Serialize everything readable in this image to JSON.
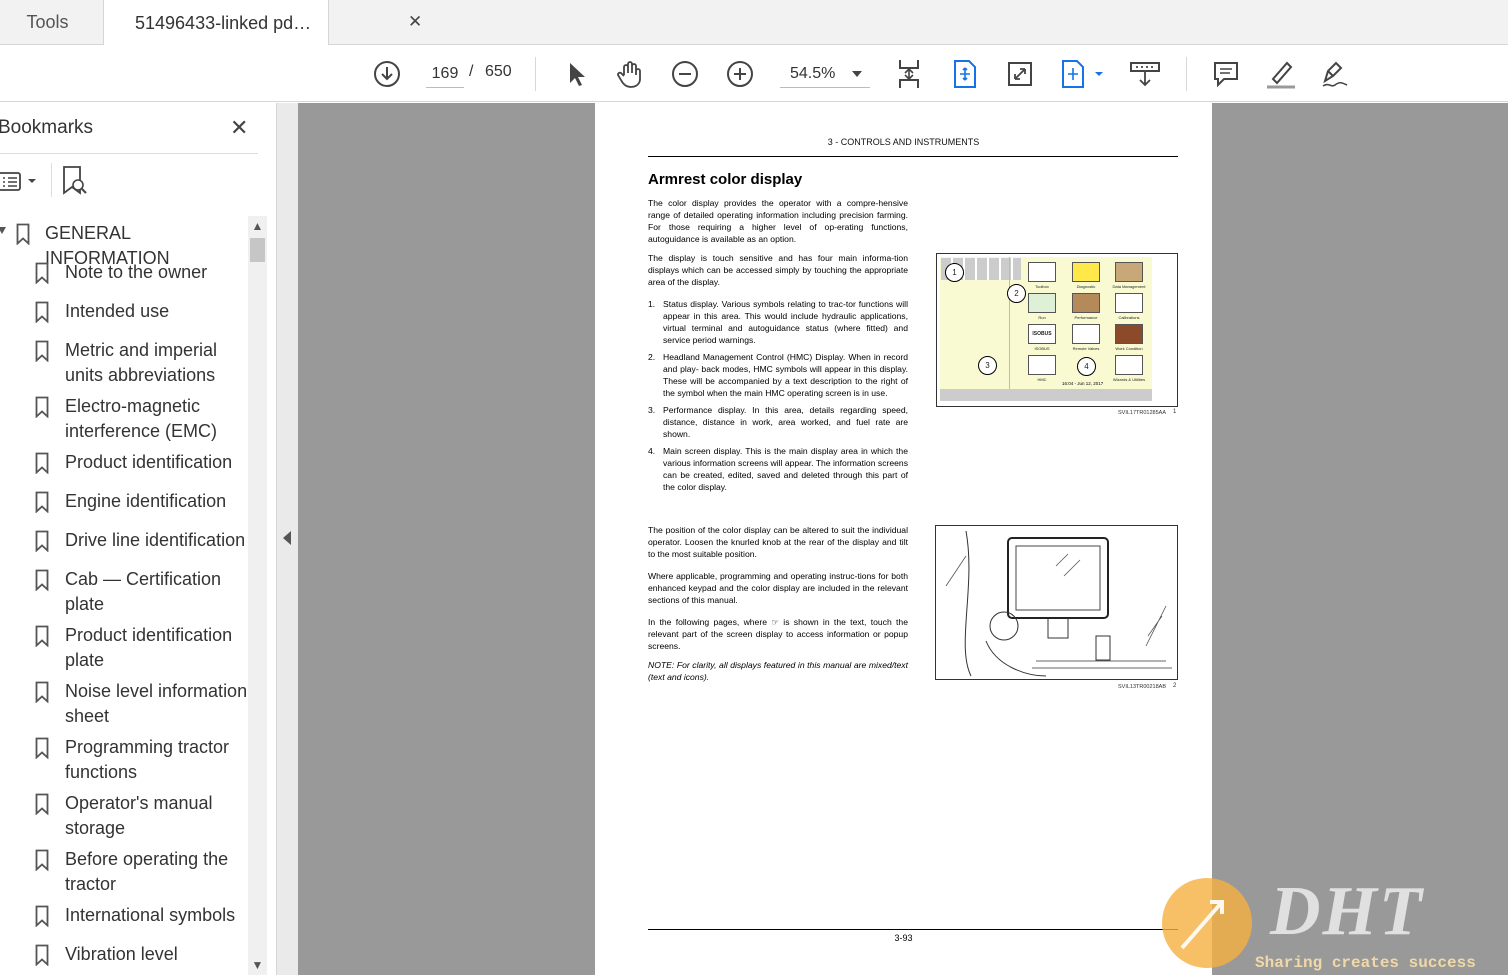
{
  "tabs": {
    "tools_label": "Tools",
    "doc_label": "51496433-linked pd…",
    "close_glyph": "✕"
  },
  "toolbar": {
    "page_current": "169",
    "page_separator": "/",
    "page_total": "650",
    "zoom_value": "54.5%"
  },
  "icons": [
    "download-icon",
    "select-cursor-icon",
    "hand-tool-icon",
    "zoom-out-icon",
    "zoom-in-icon",
    "scroll-mode-icon",
    "fit-page-icon",
    "full-screen-icon",
    "page-view-icon",
    "read-mode-icon",
    "comment-icon",
    "highlight-icon",
    "sign-icon"
  ],
  "sidebar": {
    "title": "Bookmarks",
    "close_glyph": "✕",
    "items": [
      {
        "label": "GENERAL INFORMATION"
      },
      {
        "label": "Note to the owner"
      },
      {
        "label": "Intended use"
      },
      {
        "label": "Metric and imperial units abbreviations"
      },
      {
        "label": "Electro-magnetic interference (EMC)"
      },
      {
        "label": "Product identification"
      },
      {
        "label": "Engine identification"
      },
      {
        "label": "Drive line identification"
      },
      {
        "label": "Cab — Certification plate"
      },
      {
        "label": "Product identification plate"
      },
      {
        "label": "Noise level information sheet"
      },
      {
        "label": "Programming tractor functions"
      },
      {
        "label": "Operator's manual storage"
      },
      {
        "label": "Before operating the tractor"
      },
      {
        "label": "International symbols"
      },
      {
        "label": "Vibration level"
      }
    ]
  },
  "document": {
    "header": "3 - CONTROLS AND INSTRUMENTS",
    "title": "Armrest color display",
    "p1": "The color display provides the operator with a compre-hensive range of detailed operating information including precision farming. For those requiring a higher level of op-erating functions, autoguidance is available as an option.",
    "p2": "The display is touch sensitive and has four main informa-tion displays which can be accessed simply by touching the appropriate area of the display.",
    "list": [
      {
        "n": "1.",
        "text": "Status display.  Various symbols relating to trac-tor functions will appear in this area.  This would include hydraulic applications, virtual terminal and autoguidance status (where fitted) and service period warnings."
      },
      {
        "n": "2.",
        "text": "Headland Management Control (HMC) Display. When in record and play- back modes, HMC symbols will appear in this display. These will be accompanied by a text description to the right of the symbol when the main HMC operating screen is in use."
      },
      {
        "n": "3.",
        "text": "Performance display.  In this area, details regarding speed, distance, distance in work, area worked, and fuel rate are shown."
      },
      {
        "n": "4.",
        "text": "Main screen display.  This is the main display area in which the various information screens will appear. The information screens can be created, edited, saved and deleted through this part of the color display."
      }
    ],
    "p3": "The position of the color display can be altered to suit the individual operator.  Loosen the knurled knob at the rear of the display and tilt to the most suitable position.",
    "p4": "Where applicable, programming and operating instruc-tions for both enhanced keypad and the color display are included in the relevant sections of this manual.",
    "p5": "In the following pages, where ☞ is shown in the text, touch the relevant part of the screen display to access information or popup screens.",
    "note": "NOTE: For clarity, all displays featured in this manual are mixed/text (text and icons).",
    "fig1": {
      "caption": "SVIL17TR01285AA",
      "fig_no": "1",
      "callouts": [
        "1",
        "2",
        "3",
        "4"
      ],
      "tiles": [
        "Toolbox",
        "Diagnostic",
        "Data Management",
        "Run",
        "Performance",
        "Calibrations",
        "ISOBUS",
        "Remote Valves",
        "Work Condition",
        "HMC",
        "",
        "Wizards & Utilities"
      ],
      "isobus_text": "ISOBUS",
      "status_text": "16:04 - Jun 12, 2017"
    },
    "fig2": {
      "caption": "SVIL13TR00218AB",
      "fig_no": "2"
    },
    "page_number": "3-93"
  },
  "watermark": {
    "logo_text": "DHT",
    "tagline": "Sharing creates success"
  }
}
